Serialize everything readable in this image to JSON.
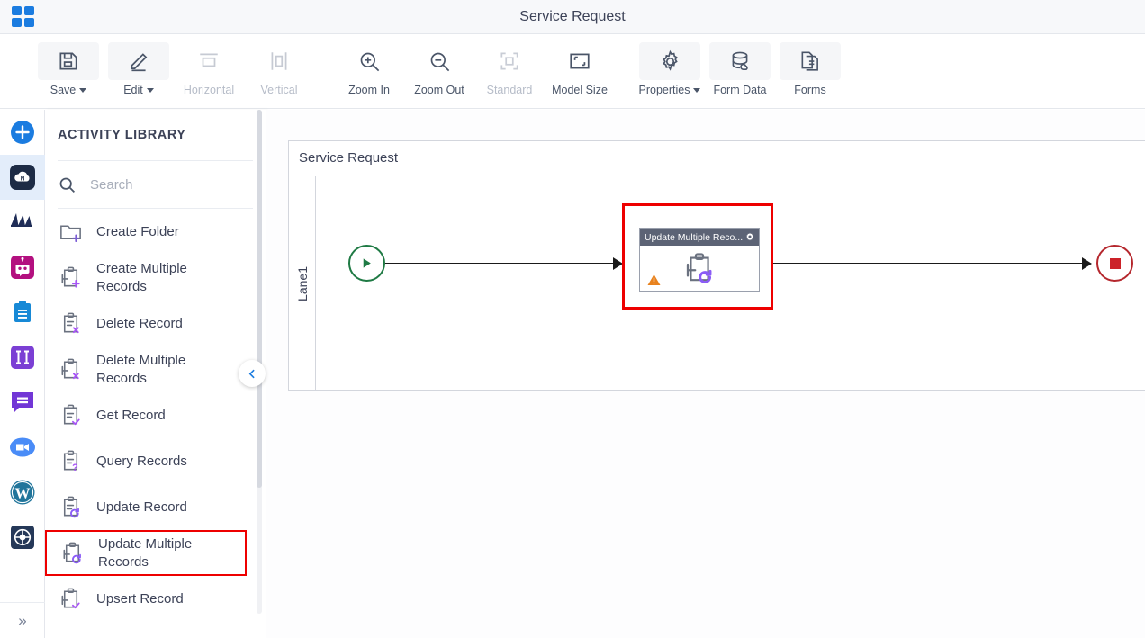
{
  "titlebar": {
    "apps_icon": "apps-grid-icon",
    "title": "Service Request"
  },
  "toolbar": {
    "items": [
      {
        "label": "Save",
        "icon": "save-icon",
        "caret": true,
        "disabled": false,
        "boxed": true
      },
      {
        "label": "Edit",
        "icon": "edit-pencil-icon",
        "caret": true,
        "disabled": false,
        "boxed": true
      },
      {
        "label": "Horizontal",
        "icon": "horizontal-icon",
        "caret": false,
        "disabled": true,
        "boxed": false
      },
      {
        "label": "Vertical",
        "icon": "vertical-icon",
        "caret": false,
        "disabled": true,
        "boxed": false
      },
      {
        "label": "Zoom In",
        "icon": "zoom-in-icon",
        "caret": false,
        "disabled": false,
        "boxed": false
      },
      {
        "label": "Zoom Out",
        "icon": "zoom-out-icon",
        "caret": false,
        "disabled": false,
        "boxed": false
      },
      {
        "label": "Standard",
        "icon": "standard-icon",
        "caret": false,
        "disabled": true,
        "boxed": false
      },
      {
        "label": "Model Size",
        "icon": "model-size-icon",
        "caret": false,
        "disabled": false,
        "boxed": false
      },
      {
        "label": "Properties",
        "icon": "gear-icon",
        "caret": true,
        "disabled": false,
        "boxed": true
      },
      {
        "label": "Form Data",
        "icon": "database-icon",
        "caret": false,
        "disabled": false,
        "boxed": true
      },
      {
        "label": "Forms",
        "icon": "forms-icon",
        "caret": false,
        "disabled": false,
        "boxed": true
      }
    ]
  },
  "rail": {
    "items": [
      {
        "name": "add-button",
        "icon": "plus-circle-icon",
        "selected": false,
        "color": "#1b7ce0"
      },
      {
        "name": "cloud-app",
        "icon": "cloud-n-icon",
        "selected": true,
        "color": "#1d2b45"
      },
      {
        "name": "dynamics-app",
        "icon": "dynamics-icon",
        "selected": false,
        "color": "#1f2d57"
      },
      {
        "name": "bot-app",
        "icon": "bot-icon",
        "selected": false,
        "color": "#b3107f"
      },
      {
        "name": "clipboard-app",
        "icon": "clipboard-icon",
        "selected": false,
        "color": "#1789d6"
      },
      {
        "name": "columns-app",
        "icon": "columns-icon",
        "selected": false,
        "color": "#7b3fd4"
      },
      {
        "name": "chat-app",
        "icon": "chat-bubble-icon",
        "selected": false,
        "color": "#7236d6"
      },
      {
        "name": "video-app",
        "icon": "video-camera-icon",
        "selected": false,
        "color": "#4a8cf7"
      },
      {
        "name": "wordpress-app",
        "icon": "wordpress-icon",
        "selected": false,
        "color": "#21759b"
      },
      {
        "name": "globe-app",
        "icon": "globe-grid-icon",
        "selected": false,
        "color": "#253858"
      }
    ],
    "expand_label": "»"
  },
  "library": {
    "title": "ACTIVITY LIBRARY",
    "search": {
      "placeholder": "Search",
      "value": "",
      "icon": "search-icon"
    },
    "collapse_icon": "chevron-left-icon",
    "items": [
      {
        "label": "Create Folder",
        "icon": "create-folder-icon",
        "highlighted": false
      },
      {
        "label": "Create Multiple Records",
        "icon": "create-multiple-records-icon",
        "highlighted": false
      },
      {
        "label": "Delete Record",
        "icon": "delete-record-icon",
        "highlighted": false
      },
      {
        "label": "Delete Multiple Records",
        "icon": "delete-multiple-records-icon",
        "highlighted": false
      },
      {
        "label": "Get Record",
        "icon": "get-record-icon",
        "highlighted": false
      },
      {
        "label": "Query Records",
        "icon": "query-records-icon",
        "highlighted": false
      },
      {
        "label": "Update Record",
        "icon": "update-record-icon",
        "highlighted": false
      },
      {
        "label": "Update Multiple Records",
        "icon": "update-multiple-records-icon",
        "highlighted": true
      },
      {
        "label": "Upsert Record",
        "icon": "upsert-record-icon",
        "highlighted": false
      }
    ]
  },
  "canvas": {
    "pool_name": "Service Request",
    "lane_name": "Lane1",
    "start_event": {
      "name": "start-event",
      "icon": "play-icon"
    },
    "end_event": {
      "name": "end-event",
      "icon": "stop-square-icon"
    },
    "task": {
      "title": "Update Multiple Reco...",
      "gear_icon": "gear-icon",
      "warning_icon": "warning-triangle-icon",
      "glyph_icon": "update-multiple-records-icon",
      "selected": true
    }
  },
  "colors": {
    "accent_blue": "#1b7ce0",
    "selection_red": "#ee0000",
    "start_green": "#1f7a44",
    "end_red": "#b5272d",
    "task_header": "#5c6375",
    "warning_orange": "#e8821e",
    "icon_purple": "#7b5bd6",
    "icon_gray": "#6b7280"
  }
}
